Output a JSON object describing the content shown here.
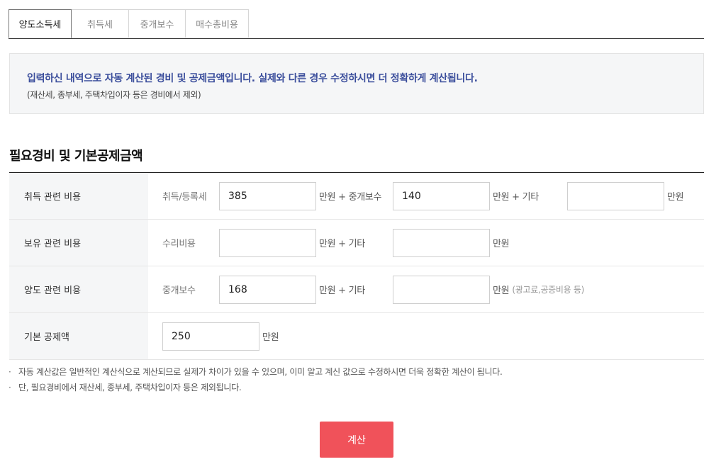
{
  "tabs": [
    {
      "label": "양도소득세",
      "active": true
    },
    {
      "label": "취득세",
      "active": false
    },
    {
      "label": "중개보수",
      "active": false
    },
    {
      "label": "매수총비용",
      "active": false
    }
  ],
  "notice": {
    "main": "입력하신 내역으로 자동 계산된 경비 및 공제금액입니다. 실제와 다른 경우 수정하시면 더 정확하게 계산됩니다.",
    "sub": "(재산세, 종부세, 주택차입이자 등은 경비에서 제외)"
  },
  "section_title": "필요경비 및 기본공제금액",
  "rows": {
    "acquisition": {
      "label": "취득 관련 비용",
      "field1_label": "취득/등록세",
      "field1_value": "385",
      "unit1": "만원  +  중개보수",
      "field2_value": "140",
      "unit2": "만원  +  기타",
      "field3_value": "",
      "unit3": "만원"
    },
    "holding": {
      "label": "보유 관련 비용",
      "field1_label": "수리비용",
      "field1_value": "",
      "unit1": "만원  +  기타",
      "field2_value": "",
      "unit2": "만원"
    },
    "transfer": {
      "label": "양도 관련 비용",
      "field1_label": "중개보수",
      "field1_value": "168",
      "unit1": "만원  +  기타",
      "field2_value": "",
      "unit2": "만원",
      "hint": "(광고료,공증비용 등)"
    },
    "deduction": {
      "label": "기본 공제액",
      "field1_value": "250",
      "unit1": "만원"
    }
  },
  "notes": [
    "자동 계산값은 일반적인 계산식으로 계산되므로 실제가 차이가 있을 수 있으며, 이미 알고 계신 값으로 수정하시면 더욱 정확한 계산이 됩니다.",
    "단, 필요경비에서 재산세, 종부세, 주택차입이자 등은 제외됩니다."
  ],
  "button": {
    "label": "계산"
  },
  "colors": {
    "accent_button": "#f0525a",
    "notice_text": "#3b4e9c"
  }
}
